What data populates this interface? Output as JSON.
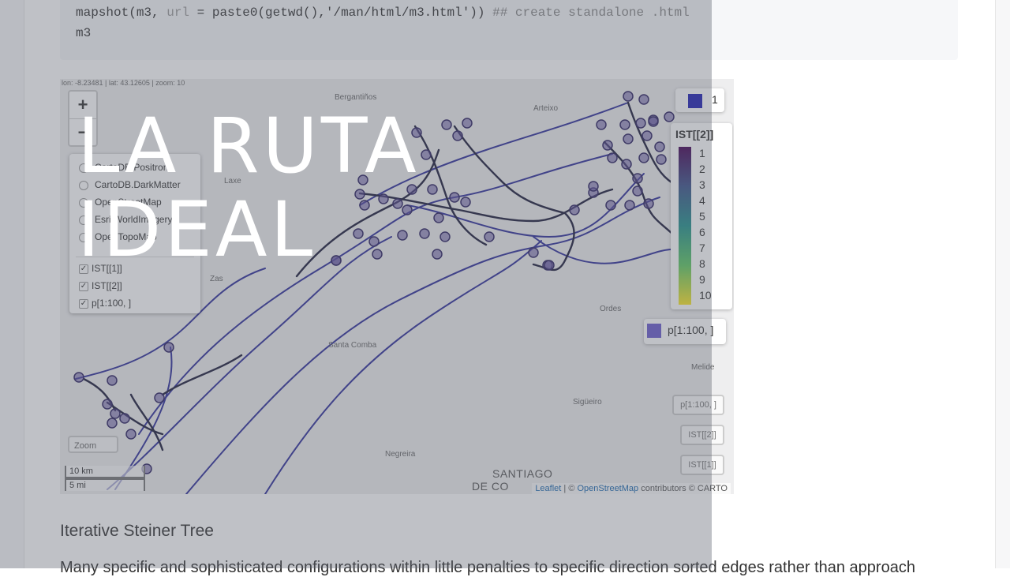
{
  "code": {
    "line1_call": "mapshot(m3, ",
    "line1_arg": "url",
    "line1_rest": " = paste0(getwd(),'/man/html/m3.html')) ",
    "line1_comment": "## create standalone .html",
    "line2": "m3"
  },
  "map": {
    "coordinates": "lon: -8.23481 | lat: 43.12605 | zoom: 10",
    "zoom_in": "+",
    "zoom_out": "−",
    "zoom_home": "Zoom",
    "layers": {
      "base": [
        "CartoDB.Positron",
        "CartoDB.DarkMatter",
        "OpenStreetMap",
        "Esri.WorldImagery",
        "OpenTopoMap"
      ],
      "overlays": [
        "IST[[1]]",
        "IST[[2]]",
        "p[1:100, ]"
      ]
    },
    "legend_1": {
      "label": "1",
      "color": "#1f1fb4"
    },
    "legend_2": {
      "title": "IST[[2]]",
      "ticks": [
        "1",
        "2",
        "3",
        "4",
        "5",
        "6",
        "7",
        "8",
        "9",
        "10"
      ]
    },
    "legend_3": {
      "label": "p[1:100, ]",
      "color": "#6a5acd"
    },
    "layer_buttons": [
      "p[1:100, ]",
      "IST[[2]]",
      "IST[[1]]"
    ],
    "scale": {
      "metric": "10 km",
      "imperial": "5 mi"
    },
    "place_labels": [
      "Bergantiños",
      "Arteixo",
      "Laxe",
      "Zas",
      "Santa Comba",
      "Ordes",
      "Sigüeiro",
      "Negreira",
      "Melide"
    ],
    "city_label_line1": "SANTIAGO",
    "city_label_line2": "DE CO",
    "attribution_leaflet": "Leaflet",
    "attribution_sep": " | © ",
    "attribution_osm": "OpenStreetMap",
    "attribution_rest": " contributors © CARTO"
  },
  "content": {
    "heading": "Iterative Steiner Tree",
    "paragraph": "Many specific and sophisticated configurations within little penalties to specific direction sorted edges rather than approach"
  },
  "overlay": {
    "title_line1": "LA RUTA",
    "title_line2": "IDEAL"
  },
  "colors": {
    "route_dark": "#1b1b3a",
    "route_blue": "#2d2d9a",
    "node": "#5b4a9c",
    "overlay": "#606470"
  }
}
